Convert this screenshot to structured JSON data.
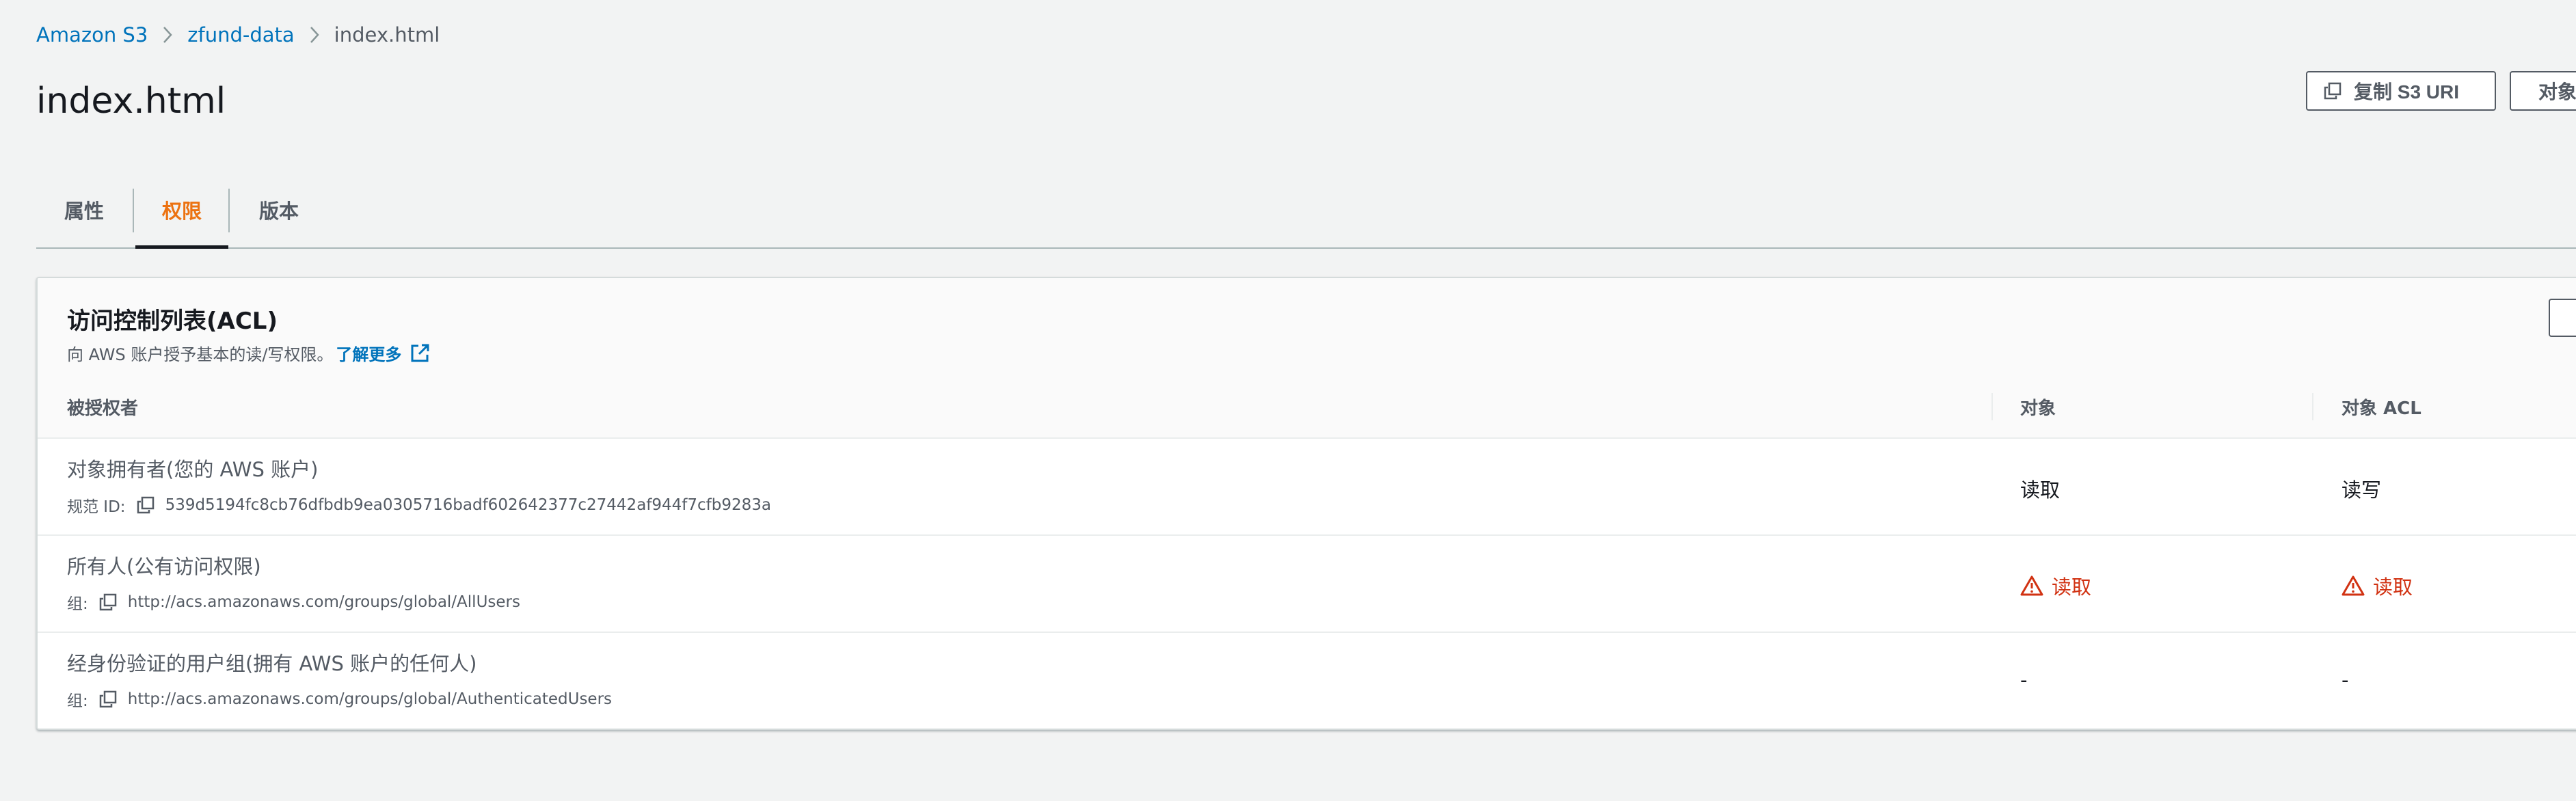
{
  "breadcrumb": {
    "items": [
      "Amazon S3",
      "zfund-data"
    ],
    "current": "index.html"
  },
  "header": {
    "title": "index.html",
    "copy_uri_label": "复制 S3 URI",
    "object_btn_label": "对象"
  },
  "tabs": [
    {
      "label": "属性",
      "active": false
    },
    {
      "label": "权限",
      "active": true
    },
    {
      "label": "版本",
      "active": false
    }
  ],
  "acl": {
    "title": "访问控制列表(ACL)",
    "description": "向 AWS 账户授予基本的读/写权限。",
    "learn_more": "了解更多",
    "columns": [
      "被授权者",
      "对象",
      "对象 ACL"
    ],
    "rows": [
      {
        "grantee": "对象拥有者(您的 AWS 账户)",
        "sub_label": "规范 ID:",
        "sub_value": "539d5194fc8cb76dfbdb9ea0305716badf602642377c27442af944f7cfb9283a",
        "object": "读取",
        "object_warn": false,
        "object_acl": "读写",
        "object_acl_warn": false
      },
      {
        "grantee": "所有人(公有访问权限)",
        "sub_label": "组:",
        "sub_value": "http://acs.amazonaws.com/groups/global/AllUsers",
        "object": "读取",
        "object_warn": true,
        "object_acl": "读取",
        "object_acl_warn": true
      },
      {
        "grantee": "经身份验证的用户组(拥有 AWS 账户的任何人)",
        "sub_label": "组:",
        "sub_value": "http://acs.amazonaws.com/groups/global/AuthenticatedUsers",
        "object": "-",
        "object_warn": false,
        "object_acl": "-",
        "object_acl_warn": false
      }
    ]
  },
  "colors": {
    "link": "#0073bb",
    "active_tab": "#ec7211",
    "warning": "#d13212",
    "background": "#f2f3f3"
  }
}
